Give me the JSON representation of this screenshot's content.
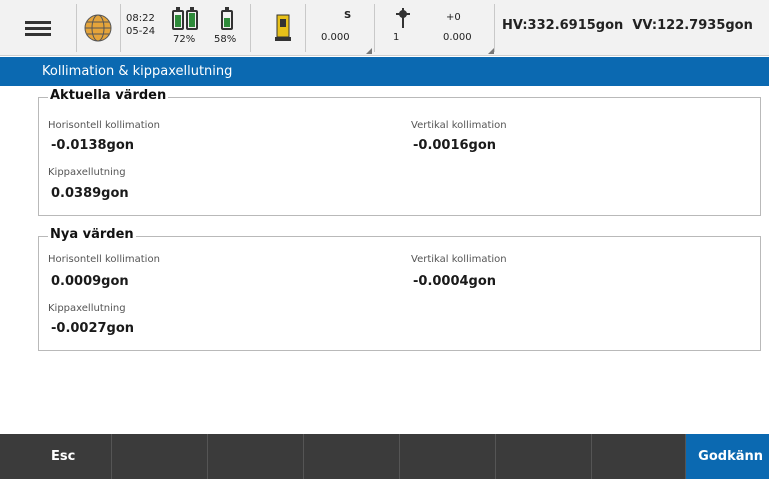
{
  "status_bar": {
    "menu_icon": "hamburger-menu-icon",
    "globe_icon": "globe-icon",
    "time": "08:22",
    "date": "05-24",
    "battery1_pct": "72%",
    "battery2_pct": "58%",
    "battery3_pct": "58%",
    "battery1_level": 0.72,
    "battery2_level": 0.58,
    "instrument_icon": "total-station-icon",
    "s_label": "S",
    "s_value": "0.000",
    "target_icon": "prism-target-icon",
    "target_number": "1",
    "offset_label": "+0",
    "offset_value": "0.000",
    "hv": "HV:332.6915gon",
    "vv": "VV:122.7935gon"
  },
  "title": "Kollimation & kippaxellutning",
  "current": {
    "heading": "Aktuella värden",
    "hz_label": "Horisontell kollimation",
    "hz_value": "-0.0138gon",
    "vz_label": "Vertikal kollimation",
    "vz_value": "-0.0016gon",
    "tilt_label": "Kippaxellutning",
    "tilt_value": "0.0389gon"
  },
  "new": {
    "heading": "Nya värden",
    "hz_label": "Horisontell kollimation",
    "hz_value": "0.0009gon",
    "vz_label": "Vertikal kollimation",
    "vz_value": "-0.0004gon",
    "tilt_label": "Kippaxellutning",
    "tilt_value": "-0.0027gon"
  },
  "softkeys": {
    "esc": "Esc",
    "accept": "Godkänn"
  },
  "colors": {
    "accent": "#0b69b1",
    "bottom_bar": "#3b3b3b",
    "battery_fill": "#2e8b3a"
  }
}
